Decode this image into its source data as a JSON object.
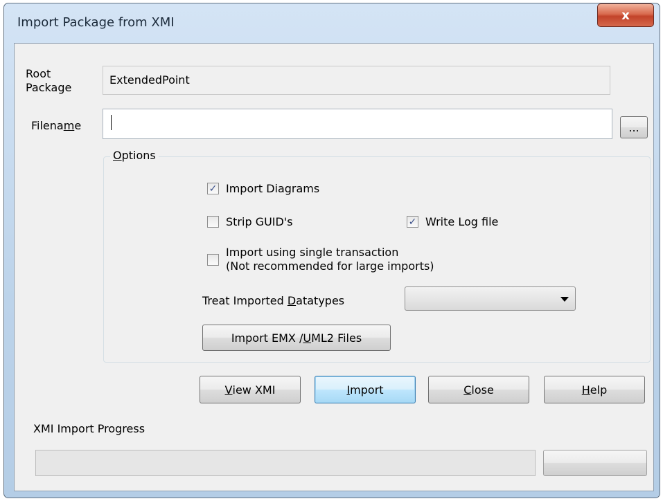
{
  "window": {
    "title": "Import Package from XMI",
    "close_label": "x"
  },
  "root_package": {
    "label_line1": "Root",
    "label_line2": "Package",
    "value": "ExtendedPoint"
  },
  "filename": {
    "label_pre": "Filena",
    "label_u": "m",
    "label_post": "e",
    "value": "",
    "browse_label": "..."
  },
  "options": {
    "legend_u": "O",
    "legend_post": "ptions",
    "import_diagrams": {
      "label": "Import Diagrams",
      "checked": true
    },
    "strip_guids": {
      "label": "Strip GUID's",
      "checked": false
    },
    "write_log": {
      "label": "Write Log file",
      "checked": true
    },
    "single_transaction": {
      "line1": "Import using single transaction",
      "line2": "(Not recommended for large imports)",
      "checked": false
    },
    "treat_datatypes": {
      "label_pre": "Treat Imported ",
      "label_u": "D",
      "label_post": "atatypes",
      "selected": ""
    },
    "import_emx": {
      "label_pre": "Import EMX / ",
      "label_u": "U",
      "label_post": "ML2 Files"
    }
  },
  "buttons": {
    "view_xmi": {
      "u": "V",
      "rest": "iew XMI"
    },
    "import": {
      "u": "I",
      "rest": "mport"
    },
    "close": {
      "u": "C",
      "rest": "lose"
    },
    "help": {
      "u": "H",
      "rest": "elp"
    }
  },
  "progress": {
    "label": "XMI Import Progress",
    "value": 0
  },
  "colors": {
    "title_bar": "#bcd3ea",
    "close_button": "#c2432a",
    "default_button": "#bee6fd",
    "checkmark": "#3a4f8a"
  }
}
